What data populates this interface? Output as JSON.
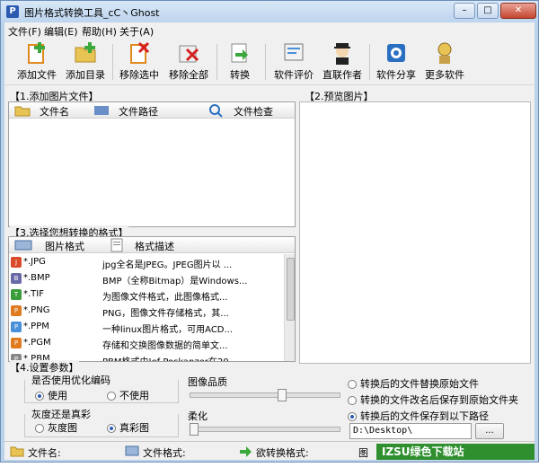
{
  "window": {
    "title": "图片格式转换工具_cC丶Ghost",
    "app_icon": "P",
    "min_glyph": "–",
    "max_glyph": "□",
    "close_glyph": "✕"
  },
  "menu": [
    "文件(F)",
    "编辑(E)",
    "帮助(H)",
    "关于(A)"
  ],
  "toolbar": {
    "add_file": "添加文件",
    "add_dir": "添加目录",
    "remove_selected": "移除选中",
    "remove_all": "移除全部",
    "convert": "转换",
    "rate": "软件评价",
    "contact": "直联作者",
    "share": "软件分享",
    "more": "更多软件"
  },
  "section1": {
    "title": "【1.添加图片文件】",
    "col_name": "文件名",
    "col_path": "文件路径",
    "col_check": "文件检查"
  },
  "section2": {
    "title": "【2.预览图片】"
  },
  "section3": {
    "title": "【3.选择您想转换的格式】",
    "col_format": "图片格式",
    "col_desc": "格式描述",
    "formats": [
      {
        "ext": "*.JPG",
        "desc": "jpg全名是JPEG。JPEG图片以 ...",
        "badge": "JPG",
        "color": "#d94b2b"
      },
      {
        "ext": "*.BMP",
        "desc": "BMP（全称Bitmap）是Windows...",
        "badge": "BMP",
        "color": "#6a6aa8"
      },
      {
        "ext": "*.TIF",
        "desc": "为图像文件格式，此图像格式...",
        "badge": "TIF",
        "color": "#3b9c3b"
      },
      {
        "ext": "*.PNG",
        "desc": "PNG，图像文件存储格式，其...",
        "badge": "PNG",
        "color": "#e07a1f"
      },
      {
        "ext": "*.PPM",
        "desc": "一种linux图片格式，可用ACD...",
        "badge": "PPM",
        "color": "#4a90d9"
      },
      {
        "ext": "*.PGM",
        "desc": "存储和交换图像数据的简单文...",
        "badge": "PGM",
        "color": "#e07a1f"
      },
      {
        "ext": "*.PBM",
        "desc": "PBM格式由Jef Poskanzer在20...",
        "badge": "PBM",
        "color": "#888888"
      }
    ]
  },
  "section4": {
    "title": "【4.设置参数】",
    "optimize_label": "是否使用优化编码",
    "use": "使用",
    "not_use": "不使用",
    "gray_label": "灰度还是真彩",
    "gray": "灰度图",
    "color": "真彩图",
    "quality_label": "图像品质",
    "quality_value": 0.62,
    "soften_label": "柔化",
    "soften_value": 0.0,
    "opt_replace": "转换后的文件替换原始文件",
    "opt_rename": "转换的文件改名后保存到原始文件夹",
    "opt_saveto": "转换后的文件保存到以下路径",
    "path": "D:\\Desktop\\",
    "browse": "..."
  },
  "status": {
    "filename": "文件名:",
    "fileformat": "文件格式:",
    "target": "欲转换格式:",
    "extra": "图",
    "watermark": "IZSU绿色下载站 www.jz5u.com"
  }
}
